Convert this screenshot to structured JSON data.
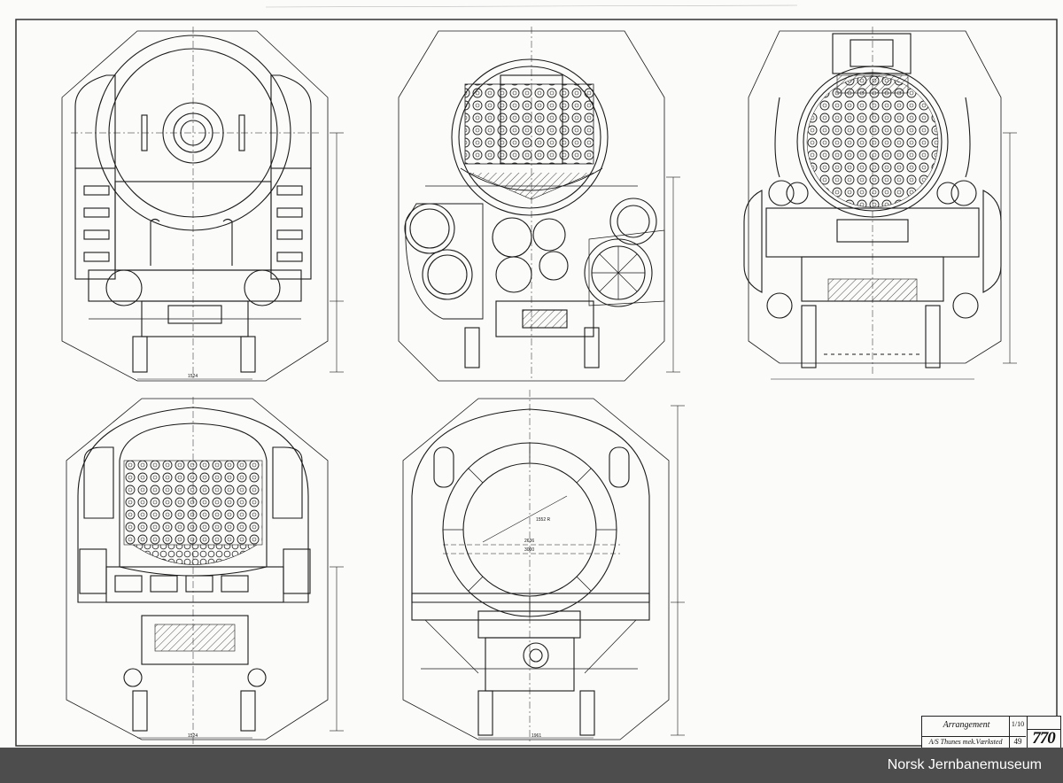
{
  "title_block": {
    "title": "Arrangement",
    "manufacturer": "A/S Thunes mek.Værksted",
    "scale": "1/10",
    "sheet_number": "49",
    "drawing_number": "770"
  },
  "views": [
    {
      "id": "front-elevation"
    },
    {
      "id": "smokebox-section"
    },
    {
      "id": "tubeplate-section"
    },
    {
      "id": "firebox-section"
    },
    {
      "id": "rear-elevation"
    }
  ],
  "dimension_labels": {
    "rear_circle": "1552 R",
    "rear_w1": "2636",
    "rear_w2": "3000",
    "front_base": "1524",
    "section_base": "1961",
    "tube_base": "1524"
  },
  "footer": {
    "credit": "Norsk Jernbanemuseum"
  },
  "colors": {
    "paper": "#fbfbfa",
    "ink": "#1a1a1a",
    "footer_bar": "#4d4d4d",
    "footer_text": "#ffffff"
  }
}
